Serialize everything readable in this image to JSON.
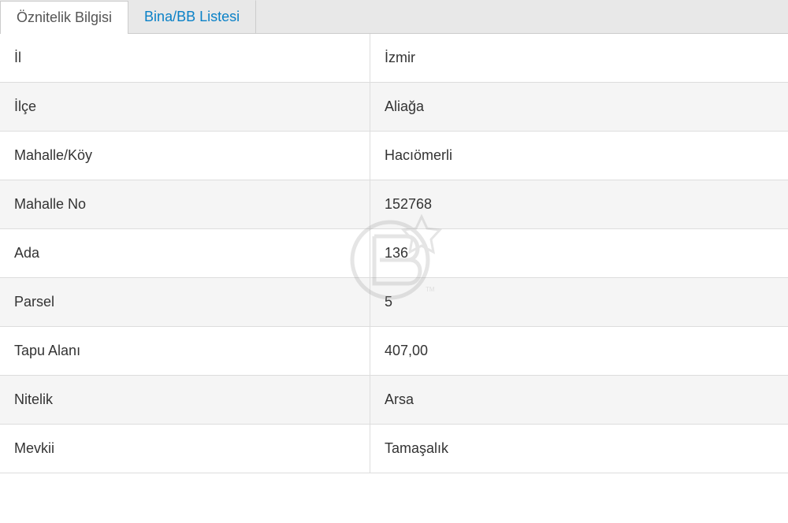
{
  "tabs": {
    "active": "Öznitelik Bilgisi",
    "inactive": "Bina/BB Listesi"
  },
  "rows": [
    {
      "label": "İl",
      "value": "İzmir"
    },
    {
      "label": "İlçe",
      "value": "Aliağa"
    },
    {
      "label": "Mahalle/Köy",
      "value": "Hacıömerli"
    },
    {
      "label": "Mahalle No",
      "value": "152768"
    },
    {
      "label": "Ada",
      "value": "136"
    },
    {
      "label": "Parsel",
      "value": "5"
    },
    {
      "label": "Tapu Alanı",
      "value": "407,00"
    },
    {
      "label": "Nitelik",
      "value": "Arsa"
    },
    {
      "label": "Mevkii",
      "value": "Tamaşalık"
    }
  ]
}
